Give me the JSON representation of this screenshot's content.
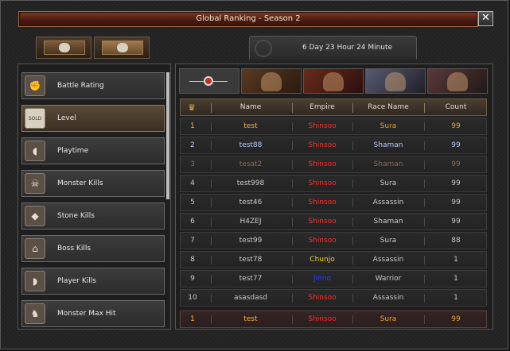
{
  "window": {
    "title": "Global Ranking - Season 2",
    "close_label": "✕"
  },
  "top_tabs": [
    {
      "icon": "globe-icon",
      "active": false
    },
    {
      "icon": "group-icon",
      "active": true
    }
  ],
  "timer": {
    "text": "6 Day 23 Hour 24 Minute"
  },
  "categories": [
    {
      "label": "Battle Rating",
      "icon": "fist-icon",
      "glyph": "✊",
      "active": false
    },
    {
      "label": "Level",
      "icon": "sold-icon",
      "glyph": "SOLD",
      "active": true
    },
    {
      "label": "Playtime",
      "icon": "feather-icon",
      "glyph": "◖",
      "active": false
    },
    {
      "label": "Monster Kills",
      "icon": "demon-icon",
      "glyph": "☠",
      "active": false
    },
    {
      "label": "Stone Kills",
      "icon": "beast-icon",
      "glyph": "◆",
      "active": false
    },
    {
      "label": "Boss Kills",
      "icon": "gate-icon",
      "glyph": "⌂",
      "active": false
    },
    {
      "label": "Player Kills",
      "icon": "fish-icon",
      "glyph": "◗",
      "active": false
    },
    {
      "label": "Monster Max Hit",
      "icon": "creature-icon",
      "glyph": "♞",
      "active": false
    }
  ],
  "race_filters": [
    {
      "name": "all",
      "icon": "emblem-icon"
    },
    {
      "name": "warrior",
      "icon": "warrior-portrait-icon"
    },
    {
      "name": "assassin",
      "icon": "assassin-portrait-icon"
    },
    {
      "name": "sura",
      "icon": "sura-portrait-icon"
    },
    {
      "name": "shaman",
      "icon": "shaman-portrait-icon"
    }
  ],
  "table": {
    "headers": {
      "name": "Name",
      "empire": "Empire",
      "race": "Race Name",
      "count": "Count"
    },
    "rows": [
      {
        "rank": "1",
        "name": "test",
        "empire": "Shinsoo",
        "race": "Sura",
        "count": "99",
        "empire_color": "#ff2a2a",
        "race_color": "#e8a030",
        "count_color": "#e8a030",
        "text_color": "#ffb040"
      },
      {
        "rank": "2",
        "name": "test88",
        "empire": "Shinsoo",
        "race": "Shaman",
        "count": "99",
        "empire_color": "#ff2a2a",
        "race_color": "#b8c8ff",
        "count_color": "#b8c8ff",
        "text_color": "#b8c8ff"
      },
      {
        "rank": "3",
        "name": "tesat2",
        "empire": "Shinsoo",
        "race": "Shaman",
        "count": "99",
        "empire_color": "#ff2a2a",
        "race_color": "#8a6a5a",
        "count_color": "#8a6a5a",
        "text_color": "#8a6a5a"
      },
      {
        "rank": "4",
        "name": "test998",
        "empire": "Shinsoo",
        "race": "Sura",
        "count": "99",
        "empire_color": "#ff2a2a",
        "race_color": "#c8c8c8",
        "count_color": "#c8c8c8",
        "text_color": "#c8c8c8"
      },
      {
        "rank": "5",
        "name": "test46",
        "empire": "Shinsoo",
        "race": "Assassin",
        "count": "99",
        "empire_color": "#ff2a2a",
        "race_color": "#c8c8c8",
        "count_color": "#c8c8c8",
        "text_color": "#c8c8c8"
      },
      {
        "rank": "6",
        "name": "H4ZEJ",
        "empire": "Shinsoo",
        "race": "Shaman",
        "count": "99",
        "empire_color": "#ff2a2a",
        "race_color": "#c8c8c8",
        "count_color": "#c8c8c8",
        "text_color": "#c8c8c8"
      },
      {
        "rank": "7",
        "name": "test99",
        "empire": "Shinsoo",
        "race": "Sura",
        "count": "88",
        "empire_color": "#ff2a2a",
        "race_color": "#c8c8c8",
        "count_color": "#c8c8c8",
        "text_color": "#c8c8c8"
      },
      {
        "rank": "8",
        "name": "test78",
        "empire": "Chunjo",
        "race": "Assassin",
        "count": "1",
        "empire_color": "#f0d020",
        "race_color": "#c8c8c8",
        "count_color": "#c8c8c8",
        "text_color": "#c8c8c8"
      },
      {
        "rank": "9",
        "name": "test77",
        "empire": "Jinno",
        "race": "Warrior",
        "count": "1",
        "empire_color": "#2a3cff",
        "race_color": "#c8c8c8",
        "count_color": "#c8c8c8",
        "text_color": "#c8c8c8"
      },
      {
        "rank": "10",
        "name": "asasdasd",
        "empire": "Shinsoo",
        "race": "Assassin",
        "count": "1",
        "empire_color": "#ff2a2a",
        "race_color": "#c8c8c8",
        "count_color": "#c8c8c8",
        "text_color": "#c8c8c8"
      }
    ],
    "own_row": {
      "rank": "1",
      "name": "test",
      "empire": "Shinsoo",
      "race": "Sura",
      "count": "99",
      "empire_color": "#ff2a2a",
      "race_color": "#e8a030",
      "count_color": "#e8a030",
      "text_color": "#ffb040"
    }
  }
}
